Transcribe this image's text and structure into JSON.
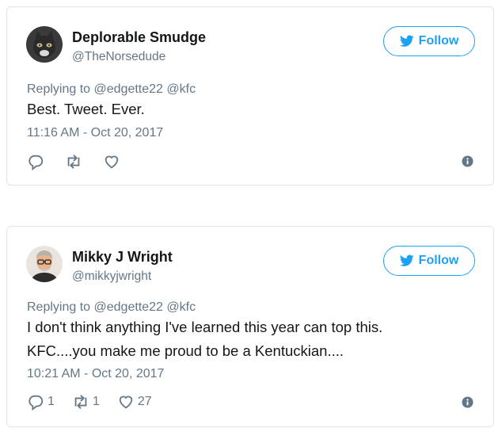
{
  "colors": {
    "accent": "#1da1f2",
    "muted": "#657786",
    "text": "#14171a",
    "border": "#dfe4e8"
  },
  "tweets": [
    {
      "name": "Deplorable Smudge",
      "handle": "@TheNorsedude",
      "follow_label": "Follow",
      "replying_prefix": "Replying to",
      "replying_to": [
        "@edgette22",
        "@kfc"
      ],
      "text_lines": [
        "Best. Tweet. Ever."
      ],
      "timestamp": "11:16 AM - Oct 20, 2017",
      "replies": "",
      "retweets": "",
      "likes": "",
      "avatar_icon": "cat-avatar"
    },
    {
      "name": "Mikky J Wright",
      "handle": "@mikkyjwright",
      "follow_label": "Follow",
      "replying_prefix": "Replying to",
      "replying_to": [
        "@edgette22",
        "@kfc"
      ],
      "text_lines": [
        "I don't think anything I've learned this year can top this.",
        "KFC....you make me proud to be a Kentuckian...."
      ],
      "timestamp": "10:21 AM - Oct 20, 2017",
      "replies": "1",
      "retweets": "1",
      "likes": "27",
      "avatar_icon": "man-avatar"
    }
  ]
}
